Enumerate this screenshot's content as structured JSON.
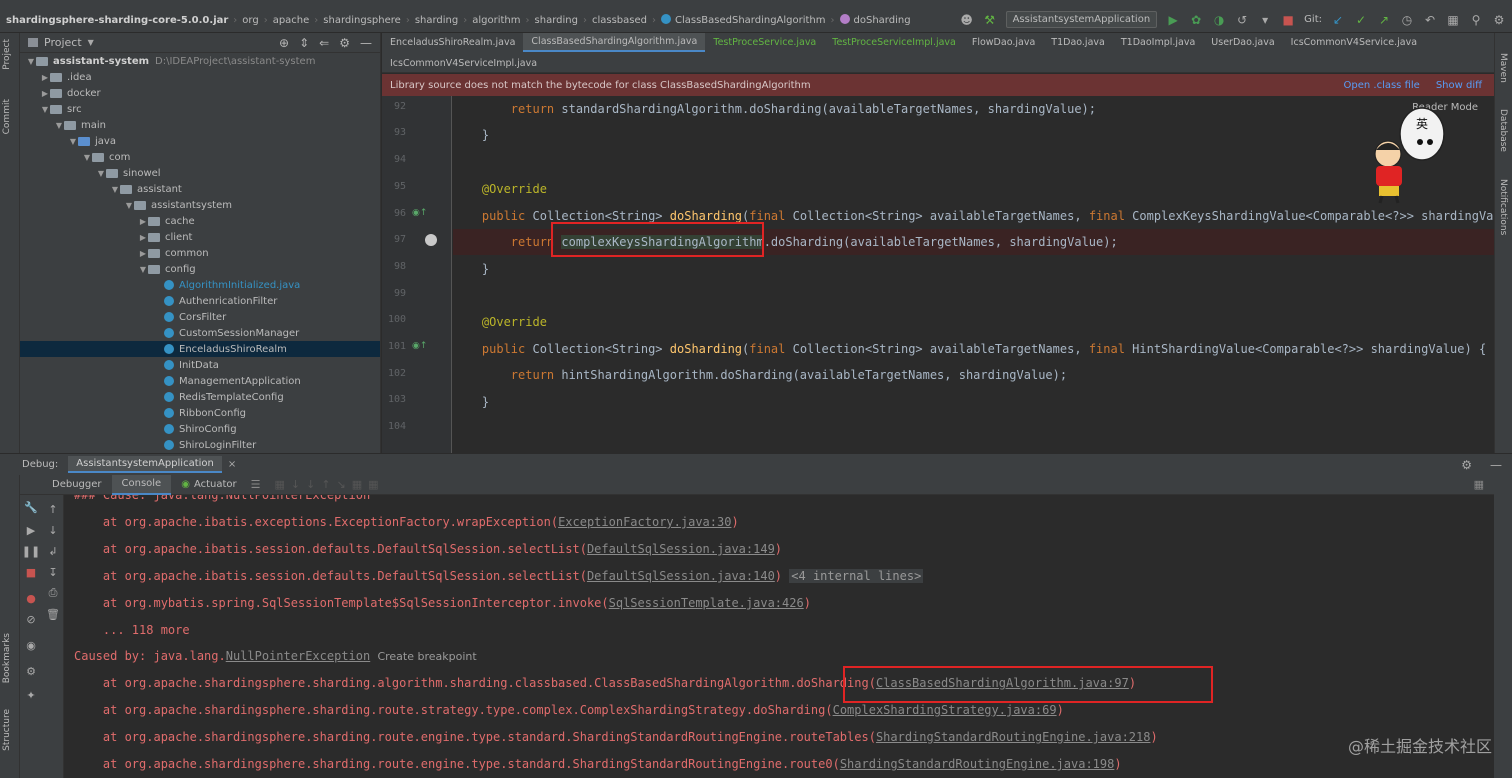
{
  "navbar": {
    "crumbs": [
      "shardingsphere-sharding-core-5.0.0.jar",
      "org",
      "apache",
      "shardingsphere",
      "sharding",
      "algorithm",
      "sharding",
      "classbased",
      "ClassBasedShardingAlgorithm",
      "doSharding"
    ],
    "run_config": "AssistantsystemApplication",
    "git_label": "Git:"
  },
  "left_strip": {
    "project": "Project",
    "commit": "Commit",
    "bookmarks": "Bookmarks",
    "structure": "Structure"
  },
  "right_strip": {
    "maven": "Maven",
    "database": "Database",
    "notifications": "Notifications"
  },
  "project": {
    "title": "Project",
    "root_name": "assistant-system",
    "root_path": "D:\\IDEAProject\\assistant-system",
    "folders": [
      ".idea",
      "docker",
      "src",
      "main",
      "java",
      "com",
      "sinowel",
      "assistant",
      "assistantsystem",
      "cache",
      "client",
      "common",
      "config"
    ],
    "classes": [
      "AlgorithmInitialized.java",
      "AuthenricationFilter",
      "CorsFilter",
      "CustomSessionManager",
      "EnceladusShiroRealm",
      "InitData",
      "ManagementApplication",
      "RedisTemplateConfig",
      "RibbonConfig",
      "ShiroConfig",
      "ShiroLoginFilter"
    ]
  },
  "editor": {
    "tabs_row1": [
      "EnceladusShiroRealm.java",
      "ClassBasedShardingAlgorithm.java",
      "TestProceService.java",
      "TestProceServiceImpl.java",
      "FlowDao.java",
      "T1Dao.java",
      "T1DaoImpl.java",
      "UserDao.java",
      "IcsCommonV4Service.java"
    ],
    "tabs_row2": [
      "IcsCommonV4ServiceImpl.java"
    ],
    "banner": "Library source does not match the bytecode for class ClassBasedShardingAlgorithm",
    "banner_links": [
      "Open .class file",
      "Show diff"
    ],
    "reader_mode": "Reader Mode",
    "line_numbers": [
      "92",
      "93",
      "94",
      "95",
      "96",
      "97",
      "98",
      "99",
      "100",
      "101",
      "102",
      "103",
      "104"
    ],
    "code": {
      "l92_return": "return",
      "l92_rest": " standardShardingAlgorithm.doSharding(availableTargetNames, shardingValue);",
      "brace": "}",
      "override": "@Override",
      "public": "public",
      "collection": " Collection<String> ",
      "dosharding": "doSharding",
      "final": "final",
      "params96a": " Collection<String> availableTargetNames, ",
      "params96b": " ComplexKeysShardingValue<Comparable<?>> shardingValue) {",
      "l97_ref": "complexKeysShardingAlgorithm",
      "l97_rest": ".doSharding(availableTargetNames, shardingValue);",
      "params101a": " Collection<String> availableTargetNames, ",
      "params101b": " HintShardingValue<Comparable<?>> shardingValue) {",
      "l102_rest": " hintShardingAlgorithm.doSharding(availableTargetNames, shardingValue);"
    }
  },
  "mascot_text": "英",
  "debug": {
    "label": "Debug:",
    "session": "AssistantsystemApplication",
    "tabs": [
      "Debugger",
      "Console",
      "Actuator"
    ]
  },
  "console": {
    "l0": "### Cause: java.lang.NullPointerException",
    "l1": {
      "text": "    at org.apache.ibatis.exceptions.ExceptionFactory.wrapException(",
      "link": "ExceptionFactory.java:30",
      "end": ")"
    },
    "l2": {
      "text": "    at org.apache.ibatis.session.defaults.DefaultSqlSession.selectList(",
      "link": "DefaultSqlSession.java:149",
      "end": ")"
    },
    "l3": {
      "text": "    at org.apache.ibatis.session.defaults.DefaultSqlSession.selectList(",
      "link": "DefaultSqlSession.java:140",
      "end": ")",
      "fold": "<4 internal lines>"
    },
    "l4": {
      "text": "    at org.mybatis.spring.SqlSessionTemplate$SqlSessionInterceptor.invoke(",
      "link": "SqlSessionTemplate.java:426",
      "end": ")"
    },
    "l5": "    ... 118 more",
    "l6": {
      "text": "Caused by: java.lang.",
      "link": "NullPointerException",
      "bp": "Create breakpoint"
    },
    "l7": {
      "text": "    at org.apache.shardingsphere.sharding.algorithm.sharding.classbased.ClassBasedShardingAlgorithm.doSharding(",
      "link": "ClassBasedShardingAlgorithm.java:97",
      "end": ")"
    },
    "l8": {
      "text": "    at org.apache.shardingsphere.sharding.route.strategy.type.complex.ComplexShardingStrategy.doSharding(",
      "link": "ComplexShardingStrategy.java:69",
      "end": ")"
    },
    "l9": {
      "text": "    at org.apache.shardingsphere.sharding.route.engine.type.standard.ShardingStandardRoutingEngine.routeTables(",
      "link": "ShardingStandardRoutingEngine.java:218",
      "end": ")"
    },
    "l10": {
      "text": "    at org.apache.shardingsphere.sharding.route.engine.type.standard.ShardingStandardRoutingEngine.route0(",
      "link": "ShardingStandardRoutingEngine.java:198",
      "end": ")"
    }
  },
  "watermark": "@稀土掘金技术社区"
}
